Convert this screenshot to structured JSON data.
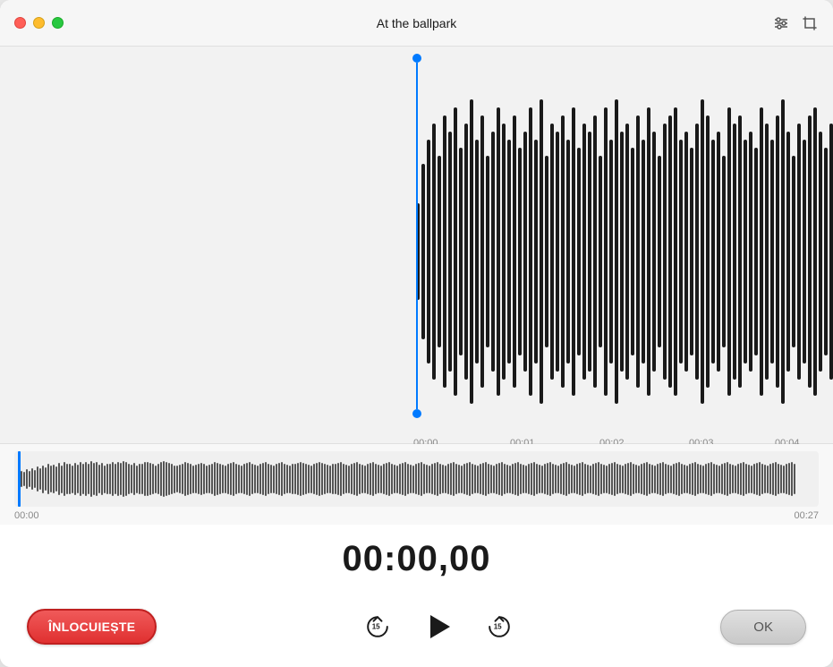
{
  "titlebar": {
    "title": "At the ballpark",
    "traffic_lights": [
      "close",
      "minimize",
      "maximize"
    ]
  },
  "toolbar": {
    "filter_icon": "filter-icon",
    "crop_icon": "crop-icon"
  },
  "zoom_view": {
    "time_markers": [
      "00:00",
      "00:01",
      "00:02",
      "00:03",
      "00:04"
    ]
  },
  "overview": {
    "time_start": "00:00",
    "time_end": "00:27"
  },
  "timer": {
    "display": "00:00,00"
  },
  "controls": {
    "replace_label": "ÎNLOCUIEȘTE",
    "skip_back_label": "15",
    "play_label": "Play",
    "skip_forward_label": "15",
    "ok_label": "OK"
  }
}
